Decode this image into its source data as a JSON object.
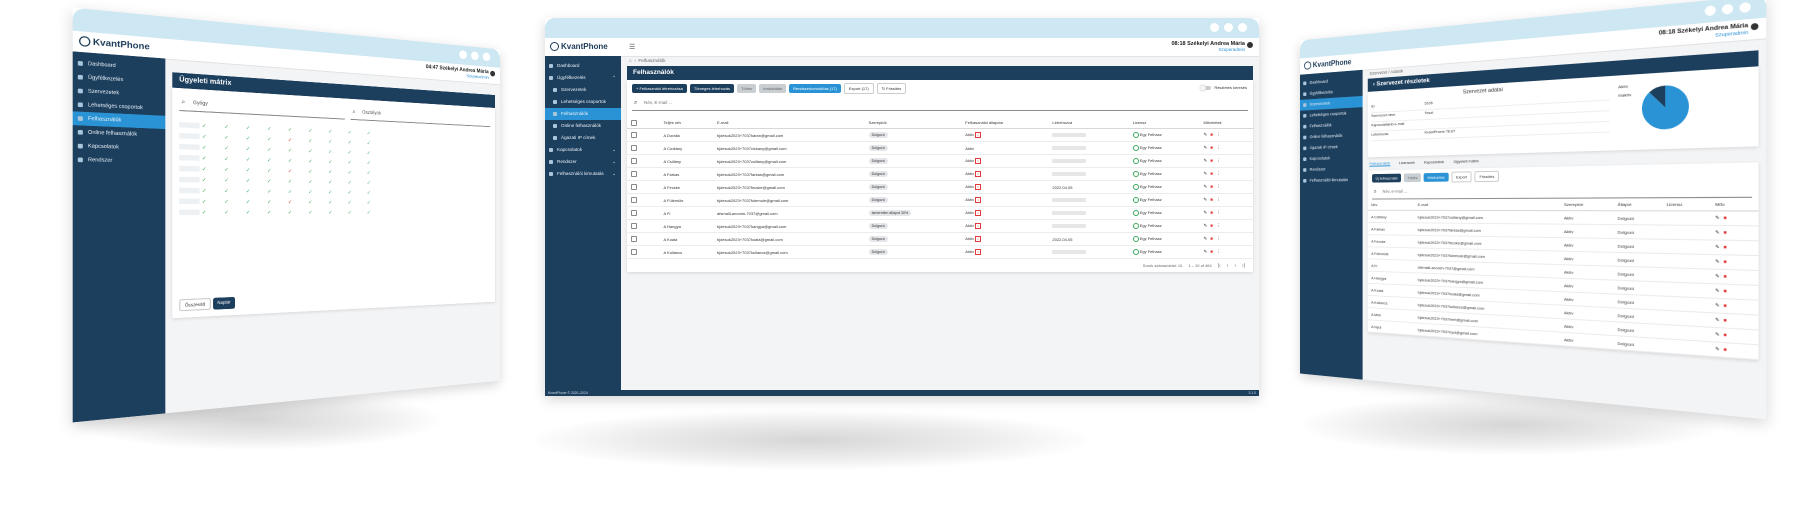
{
  "brand": {
    "name": "KvantPhone"
  },
  "colors": {
    "sidebar": "#1d3f5e",
    "accent": "#2a93d5",
    "chrome": "#cde7f3"
  },
  "left": {
    "header": {
      "time": "04:47",
      "user": "Székelyi Andrea Mária",
      "role": "Szuperadmin"
    },
    "page_title": "Ügyeleti mátrix",
    "search_value": "Gyógy",
    "search2_value": "Osztályok",
    "sidebar": [
      "Dashboard",
      "Ügyfélkezelés",
      "Szervezetek",
      "Lehetséges csoportok",
      "Felhasználók",
      "Online felhasználók",
      "Kapcsolatok",
      "Rendszer"
    ],
    "tabs": [
      "Összesítő",
      "Naptár"
    ]
  },
  "center": {
    "header": {
      "time": "08:18",
      "user": "Székelyi Andrea Mária",
      "role": "Szuperadmin"
    },
    "breadcrumb": "Felhasználók",
    "page_title": "Felhasználók",
    "sidebar": [
      {
        "label": "Dashboard",
        "icon": "dashboard-icon",
        "chev": ""
      },
      {
        "label": "Ügyfélkezelés",
        "icon": "clients-icon",
        "chev": "^"
      },
      {
        "label": "Szervezetek",
        "icon": "building-icon",
        "chev": ""
      },
      {
        "label": "Lehetséges csoportok",
        "icon": "group-icon",
        "chev": ""
      },
      {
        "label": "Felhasználók",
        "icon": "user-icon",
        "chev": ""
      },
      {
        "label": "Online felhasználók",
        "icon": "online-icon",
        "chev": ""
      },
      {
        "label": "Ágazati IP címek",
        "icon": "ip-icon",
        "chev": ""
      },
      {
        "label": "Kapcsolatok",
        "icon": "link-icon",
        "chev": "v"
      },
      {
        "label": "Rendszer",
        "icon": "system-icon",
        "chev": "v"
      },
      {
        "label": "Felhasználói kimutatás",
        "icon": "report-icon",
        "chev": "v"
      }
    ],
    "active_index": 4,
    "footer_left": "KvantPhone © 2020–2024",
    "footer_right": "3.1.0",
    "toolbar": {
      "btn_new_user": "Felhasználó létrehozása",
      "btn_bulk_create": "Tömeges létrehozás",
      "btn_delete": "Törlés",
      "btn_deactivate": "Inaktiválás",
      "btn_export_mods": "Rendszerkomódítás (17)",
      "btn_export": "Export (17)",
      "btn_refresh": "Frissítés",
      "switch_label": "Részletes keresés"
    },
    "search_placeholder": "Név, E-mail ...",
    "columns": [
      "Teljes név",
      "E-mail",
      "Szerepkör",
      "Felhasználói állapota",
      "Létrehozva",
      "Licensz",
      "Műveletek"
    ],
    "rows": [
      {
        "name": "A Dorália",
        "email": "bjdesuk2023+7037karan@gmail.com",
        "role": "Dolgozó",
        "status": "Aktív",
        "status_x": "×",
        "created": "",
        "license": "Egy Felhasz"
      },
      {
        "name": "A Cicikány",
        "email": "bjdesuk2023+7037cickany@gmail.com",
        "role": "Dolgozó",
        "status": "Aktív",
        "status_x": "",
        "created": "",
        "license": "Egy Felhasz"
      },
      {
        "name": "A Csillány",
        "email": "bjdesuk2023+7037csillany@gmail.com",
        "role": "Dolgozó",
        "status": "Aktív",
        "status_x": "×",
        "created": "",
        "license": "Egy Felhasz"
      },
      {
        "name": "A Farkas",
        "email": "bjdesuk2023+7037farkas@gmail.com",
        "role": "Dolgozó",
        "status": "Aktív",
        "status_x": "×",
        "created": "",
        "license": "Egy Felhasz"
      },
      {
        "name": "A Fecske",
        "email": "bjdesuk2023+7037fecske@gmail.com",
        "role": "Dolgozó",
        "status": "Aktív",
        "status_x": "×",
        "created": "2022.04.05",
        "license": "Egy Felhasz"
      },
      {
        "name": "A Fülemüle",
        "email": "bjdesuk2023+7037fulemule@gmail.com",
        "role": "Dolgozó",
        "status": "Aktív",
        "status_x": "×",
        "created": "",
        "license": "Egy Felhasz"
      },
      {
        "name": "A Fi",
        "email": "afsmaill-anonim-7037@gmail.com",
        "role": "Ismeretlen állapot 30%",
        "status": "Aktív",
        "status_x": "×",
        "created": "",
        "license": "Egy Felhasz"
      },
      {
        "name": "A Hangya",
        "email": "bjdesuk2023+7037hangya@gmail.com",
        "role": "Dolgozó",
        "status": "Aktív",
        "status_x": "×",
        "created": "",
        "license": "Egy Felhasz"
      },
      {
        "name": "A Koala",
        "email": "bjdesuk2023+7037koala@gmail.com",
        "role": "Dolgozó",
        "status": "Aktív",
        "status_x": "×",
        "created": "2022.04.05",
        "license": "Egy Felhasz"
      },
      {
        "name": "A Kullancs",
        "email": "bjdesuk2023+7037kullancs@gmail.com",
        "role": "Dolgozó",
        "status": "Aktív",
        "status_x": "×",
        "created": "",
        "license": "Egy Felhasz"
      }
    ],
    "pager": {
      "rows_label": "Sorok száma/oldal: 10",
      "range": "1 – 10 of 464"
    }
  },
  "right": {
    "header": {
      "time": "08:18",
      "user": "Székelyi Andrea Mária",
      "role": "Szuperadmin"
    },
    "breadcrumb": "Szervezet / Adatok",
    "page_title": "Szervezet részletek",
    "section_title": "Szervezet adatai",
    "fields": [
      {
        "label": "ID",
        "value": "5105"
      },
      {
        "label": "Szervezet neve",
        "value": "Teszt"
      },
      {
        "label": "Kapcsolattartó e-mail",
        "value": ""
      },
      {
        "label": "Létrehozás",
        "value": "KvantPhone TEST"
      }
    ],
    "chart_legend": [
      "Aktív",
      "Inaktív"
    ],
    "chart_data": {
      "type": "pie",
      "values": [
        88,
        12
      ]
    },
    "tabs": [
      "Felhasználók",
      "Licenszek",
      "Kapcsolatok",
      "Ügyeleti mátrix"
    ],
    "toolbar": {
      "btn_new": "Új felhasználó",
      "btn_delete": "Törlés",
      "btn_mods": "Módosítás",
      "btn_export": "Export",
      "btn_refresh": "Frissítés"
    },
    "search_placeholder": "Név, e-mail ...",
    "columns": [
      "Név",
      "E-mail",
      "Szerepkör",
      "Állapot",
      "Licensz",
      "Műv."
    ],
    "rows": [
      {
        "name": "A Csillány",
        "email": "bjdesuk2023+7037csillany@gmail.com",
        "role": "Aktív",
        "state": "Dolgozó"
      },
      {
        "name": "A Farkas",
        "email": "bjdesuk2023+7037farkas@gmail.com",
        "role": "Aktív",
        "state": "Dolgozó"
      },
      {
        "name": "A Fecske",
        "email": "bjdesuk2023+7037fecske@gmail.com",
        "role": "Aktív",
        "state": "Dolgozó"
      },
      {
        "name": "A Fülemüle",
        "email": "bjdesuk2023+7037fulemule@gmail.com",
        "role": "Aktív",
        "state": "Dolgozó"
      },
      {
        "name": "A Fi",
        "email": "afsmaill-anonim-7037@gmail.com",
        "role": "Aktív",
        "state": "Dolgozó"
      },
      {
        "name": "A Hangya",
        "email": "bjdesuk2023+7037hangya@gmail.com",
        "role": "Aktív",
        "state": "Dolgozó"
      },
      {
        "name": "A Koala",
        "email": "bjdesuk2023+7037koala@gmail.com",
        "role": "Aktív",
        "state": "Dolgozó"
      },
      {
        "name": "A Kullancs",
        "email": "bjdesuk2023+7037kullancs@gmail.com",
        "role": "Aktív",
        "state": "Dolgozó"
      },
      {
        "name": "A Méh",
        "email": "bjdesuk2023+7037meh@gmail.com",
        "role": "Aktív",
        "state": "Dolgozó"
      },
      {
        "name": "A Nyúl",
        "email": "bjdesuk2023+7037nyul@gmail.com",
        "role": "Aktív",
        "state": "Dolgozó"
      }
    ]
  }
}
